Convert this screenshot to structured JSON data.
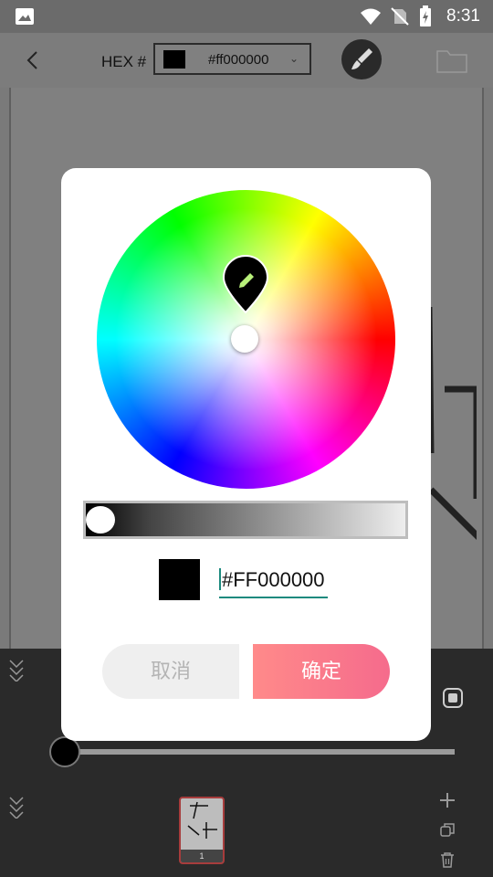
{
  "status_bar": {
    "time": "8:31",
    "icons": [
      "gallery-notification-icon",
      "wifi-icon",
      "no-sim-icon",
      "battery-charging-icon"
    ]
  },
  "toolbar": {
    "back_icon": "back-arrow-icon",
    "hex_label": "HEX #",
    "hex_value": "#ff000000",
    "dropdown_icon": "chevron-down-icon",
    "brush_icon": "brush-icon",
    "folder_icon": "folder-icon"
  },
  "color_dialog": {
    "picker_icon": "pencil-icon",
    "hex_input": "#FF000000",
    "preview_color": "#000000",
    "brightness": 0.0,
    "cancel_label": "取消",
    "confirm_label": "确定"
  },
  "bottom_panel": {
    "layer_number": "1",
    "add_icon": "plus-icon",
    "copy_icon": "copy-icon",
    "delete_icon": "trash-icon",
    "collapse_icon": "double-chevron-down-icon",
    "layer_toggle_icon": "layer-toggle-icon"
  },
  "colors": {
    "accent": "#1c8a7e",
    "confirm_start": "#ff8a8a",
    "confirm_end": "#f56b8c"
  }
}
